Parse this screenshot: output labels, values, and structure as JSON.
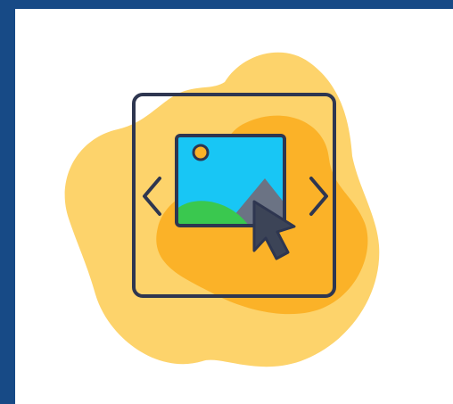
{
  "scene": {
    "description_icon": "image-carousel-icon",
    "colors": {
      "frame_border": "#174a86",
      "card_background": "#ffffff",
      "blob_light": "#fdd36b",
      "blob_dark": "#fbb228",
      "outline": "#2e3650",
      "sky": "#18c6f5",
      "sun": "#fbb228",
      "hill_green": "#3ac84f",
      "mountain_gray": "#6b7384",
      "cursor": "#3c4457"
    },
    "icons": [
      "chevron-left-icon",
      "chevron-right-icon",
      "image-icon",
      "cursor-arrow-icon"
    ]
  }
}
